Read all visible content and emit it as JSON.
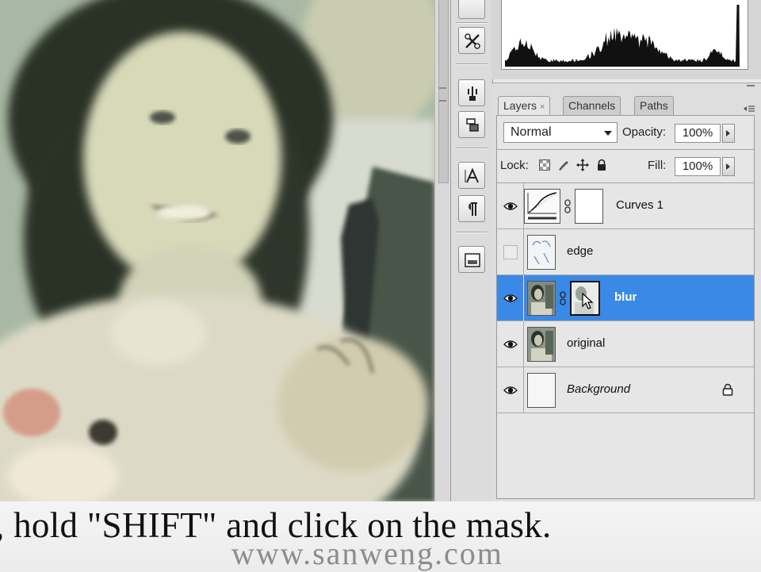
{
  "layers_panel": {
    "tabs": [
      {
        "label": "Layers",
        "close": "×",
        "active": true
      },
      {
        "label": "Channels",
        "active": false
      },
      {
        "label": "Paths",
        "active": false
      }
    ],
    "blend_mode": "Normal",
    "opacity_label": "Opacity:",
    "opacity_value": "100%",
    "lock_label": "Lock:",
    "fill_label": "Fill:",
    "fill_value": "100%",
    "layers": [
      {
        "name": "Curves 1",
        "visible": true,
        "selected": false
      },
      {
        "name": "edge",
        "visible": false,
        "selected": false
      },
      {
        "name": "blur",
        "visible": true,
        "selected": true
      },
      {
        "name": "original",
        "visible": true,
        "selected": false
      },
      {
        "name": "Background",
        "visible": true,
        "selected": false,
        "locked": true
      }
    ]
  },
  "caption": {
    "subtitle": ", hold \"SHIFT\" and click on the mask.",
    "watermark": "www.sanweng.com"
  },
  "colors": {
    "selection": "#3b89e6",
    "panel_bg": "#dedede"
  }
}
